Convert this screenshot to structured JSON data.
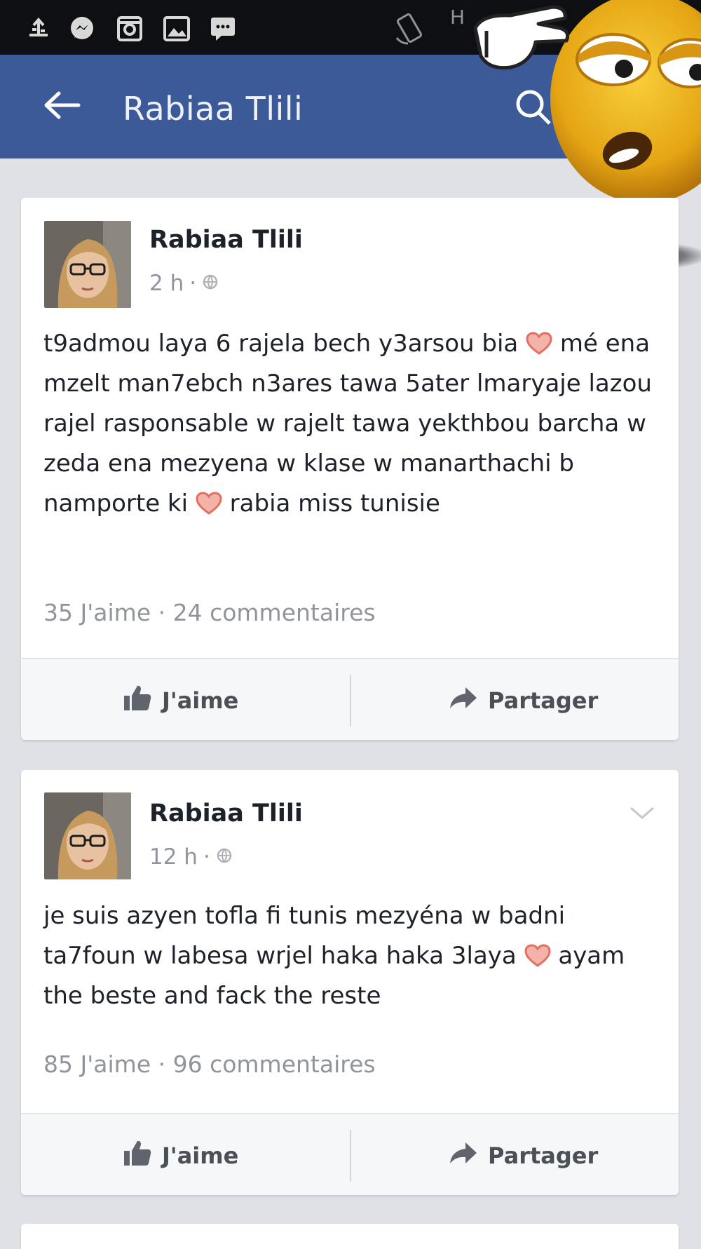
{
  "status_bar": {
    "icons": [
      "usb-icon",
      "messenger-icon",
      "instagram-icon",
      "gallery-icon",
      "sms-icon",
      "rotate-icon"
    ],
    "carrier_text": "H"
  },
  "app_bar": {
    "title": "Rabiaa Tlili",
    "icons": [
      "back-arrow-icon",
      "search-icon"
    ],
    "color": "#3c5a98"
  },
  "posts": [
    {
      "author": "Rabiaa Tlili",
      "time": "2 h",
      "text_parts": [
        "t9admou laya 6 rajela bech y3arsou bia ",
        " mé ena mzelt man7ebch n3ares tawa 5ater lmaryaje lazou rajel rasponsable w rajelt tawa yekthbou barcha w zeda ena mezyena w klase w manarthachi b namporte ki ",
        " rabia miss tunisie"
      ],
      "counts": "35 J'aime · 24 commentaires",
      "like_label": "J'aime",
      "share_label": "Partager"
    },
    {
      "author": "Rabiaa Tlili",
      "time": "12 h",
      "text_parts": [
        "je suis azyen tofla fi tunis mezyéna w badni ta7foun w labesa wrjel haka haka 3laya ",
        " ayam the beste and fack the reste"
      ],
      "counts": "85 J'aime · 96 commentaires",
      "like_label": "J'aime",
      "share_label": "Partager"
    }
  ],
  "colors": {
    "heart": "#f0a49a",
    "heart_stroke": "#e36f62",
    "text": "#1d2129",
    "muted": "#90949c"
  }
}
